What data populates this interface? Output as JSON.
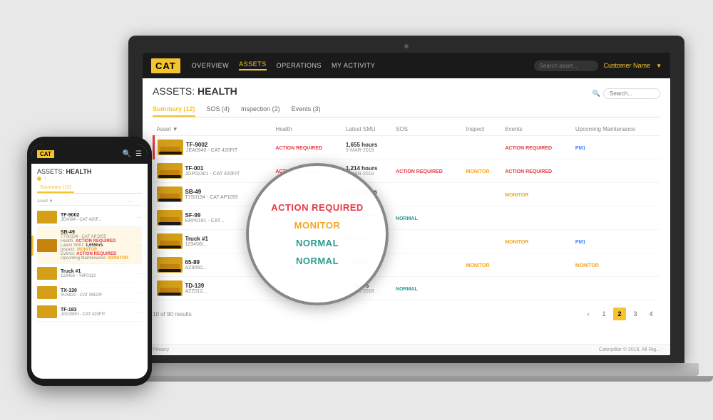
{
  "scene": {
    "background": "#e8e8e8"
  },
  "laptop": {
    "nav": {
      "logo": "CAT",
      "items": [
        "OVERVIEW",
        "ASSETS",
        "OPERATIONS",
        "MY ACTIVITY"
      ],
      "active_item": "ASSETS",
      "search_placeholder": "Search asset...",
      "customer_label": "Customer Name"
    },
    "page": {
      "title_prefix": "ASSETS: ",
      "title_bold": "HEALTH",
      "search_placeholder": "Search...",
      "tabs": [
        {
          "label": "Summary (12)",
          "active": true
        },
        {
          "label": "SOS (4)",
          "active": false
        },
        {
          "label": "Inspection (2)",
          "active": false
        },
        {
          "label": "Events (3)",
          "active": false
        }
      ],
      "table": {
        "headers": [
          "Asset ▼",
          "Health",
          "Latest SMU",
          "SOS",
          "Inspect",
          "Events",
          "Upcoming Maintenance"
        ],
        "rows": [
          {
            "name": "TF-9002",
            "sub": "JEA0940 - CAT 420FIT",
            "health": "ACTION REQUIRED",
            "health_color": "red",
            "smu": "1,655 hours",
            "smu_date": "5-MAR-2018",
            "sos": "",
            "inspect": "",
            "events": "ACTION REQUIRED",
            "events_color": "red",
            "maintenance": "PM1",
            "maintenance_color": "blue",
            "accent": true
          },
          {
            "name": "TF-001",
            "sub": "JGP01301 - CAT 420FIT",
            "health": "ACTION REQUIRED",
            "health_color": "red",
            "smu": "1,214 hours",
            "smu_date": "5-MAR-2018",
            "sos": "ACTION REQUIRED",
            "sos_color": "red",
            "inspect": "MONITOR",
            "inspect_color": "orange",
            "events": "ACTION REQUIRED",
            "events_color": "red",
            "maintenance": "",
            "accent": false
          },
          {
            "name": "SB-49",
            "sub": "T7S0194 - CAT AP1055",
            "health": "",
            "smu": "1,911 hours",
            "smu_date": "5-MAR-2018",
            "sos": "",
            "inspect": "",
            "events": "MONITOR",
            "events_color": "orange",
            "maintenance": "",
            "accent": false
          },
          {
            "name": "SF-99",
            "sub": "ERP0191 - CAT...",
            "health": "",
            "smu": "1,409 hours",
            "smu_date": "5-MAR-2018",
            "sos": "NORMAL",
            "sos_color": "green",
            "inspect": "",
            "events": "",
            "maintenance": "",
            "accent": false
          },
          {
            "name": "Truck #1",
            "sub": "123456/...",
            "health": "",
            "smu": "00 miles",
            "smu_date": "5-MAR-2018",
            "sos": "",
            "inspect": "",
            "events": "MONITOR",
            "events_color": "orange",
            "maintenance": "PM1",
            "maintenance_color": "blue",
            "accent": false
          },
          {
            "name": "65-89",
            "sub": "AZ9050...",
            "health": "",
            "smu": "hours",
            "smu_date": "5-MAR-2018",
            "sos": "",
            "inspect": "MONITOR",
            "inspect_color": "orange",
            "events": "",
            "maintenance": "MONITOR",
            "maintenance_color": "orange",
            "accent": false
          },
          {
            "name": "TD-139",
            "sub": "AZZ012...",
            "health": "",
            "smu": "hours",
            "smu_date": "5-MAR-2018",
            "sos": "NORMAL",
            "sos_color": "green",
            "inspect": "",
            "events": "",
            "maintenance": "",
            "accent": false
          }
        ]
      },
      "results_text": "10 of 90 results",
      "pagination": [
        "‹",
        "1",
        "2",
        "3",
        "4"
      ],
      "active_page": "2"
    },
    "zoom_circle": {
      "labels": [
        "ACTION REQUIRED",
        "MONITOR",
        "NORMAL",
        "NORMAL"
      ],
      "colors": [
        "red",
        "orange",
        "green",
        "green"
      ]
    },
    "footer": {
      "left": "Privacy",
      "right": "Caterpillar © 2018, All Rig..."
    }
  },
  "phone": {
    "nav": {
      "logo": "CAT"
    },
    "page": {
      "title_prefix": "ASSETS: ",
      "title_bold": "HEALTH",
      "tabs": [
        "Summary (12)"
      ],
      "rows": [
        {
          "name": "TF-9002",
          "sub": "JEA094 - CAT 420F...",
          "badges": [],
          "selected": false
        },
        {
          "name": "SB-49",
          "sub": "T7S0194 - CAT AP1055",
          "health_label": "Health:",
          "health_val": "ACTION REQUIRED",
          "health_color": "red",
          "smu_label": "Latest SMU:",
          "smu_val": "1,655hrs",
          "inspect_label": "Inspect:",
          "inspect_val": "MONITOR",
          "inspect_color": "orange",
          "events_label": "Events:",
          "events_val": "ACTION REQUIRED",
          "events_color": "red",
          "maintenance_label": "Upcoming Maintenance:",
          "maintenance_val": "MONITOR",
          "maintenance_color": "orange",
          "selected": true
        },
        {
          "name": "Truck #1",
          "sub": "123456 - Y6F0113",
          "selected": false
        },
        {
          "name": "TX-130",
          "sub": "XU5920 - CAT M322F",
          "selected": false
        },
        {
          "name": "TF-183",
          "sub": "JG0290H - CAT 420FIT",
          "selected": false
        }
      ]
    }
  }
}
